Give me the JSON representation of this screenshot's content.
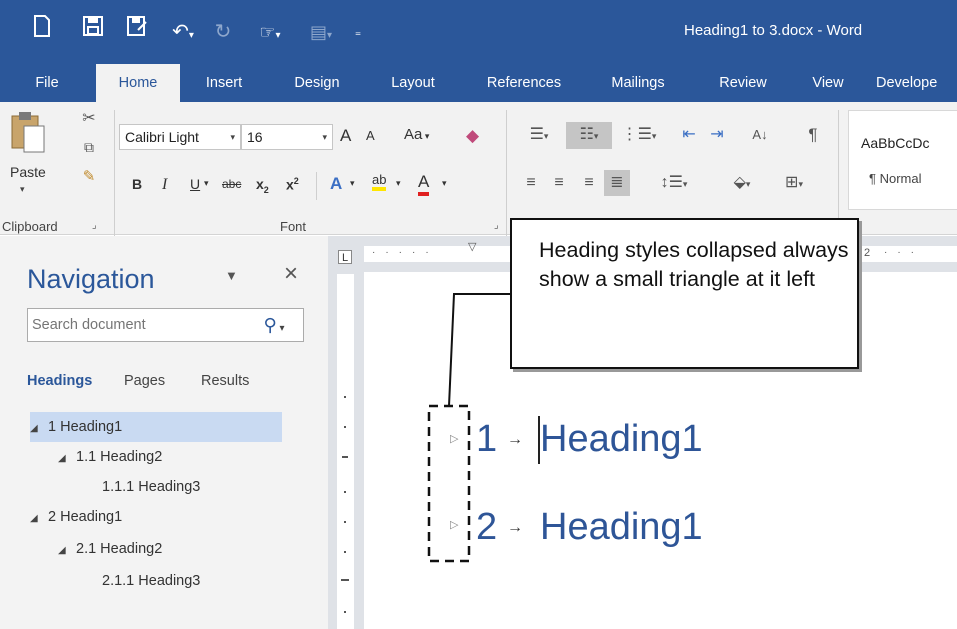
{
  "app": {
    "title": "Heading1 to 3.docx - Word"
  },
  "quick_access": {
    "icons": [
      "new-document-icon",
      "save-icon",
      "save-as-icon",
      "undo-icon",
      "redo-icon",
      "touch-mode-icon",
      "print-preview-icon",
      "customize-icon"
    ]
  },
  "tabs": [
    {
      "label": "File"
    },
    {
      "label": "Home",
      "active": true
    },
    {
      "label": "Insert"
    },
    {
      "label": "Design"
    },
    {
      "label": "Layout"
    },
    {
      "label": "References"
    },
    {
      "label": "Mailings"
    },
    {
      "label": "Review"
    },
    {
      "label": "View"
    },
    {
      "label": "Develope"
    }
  ],
  "ribbon": {
    "clipboard": {
      "paste_label": "Paste",
      "group_label": "Clipboard"
    },
    "font": {
      "font_name": "Calibri Light",
      "font_size": "16",
      "grow_label": "A",
      "shrink_label": "A",
      "case_label": "Aa",
      "bold": "B",
      "italic": "I",
      "underline": "U",
      "strike": "abc",
      "subscript": "x",
      "superscript": "x",
      "effects": "A",
      "highlight": "ab",
      "color": "A",
      "group_label": "Font"
    },
    "paragraph": {
      "pilcrow": "¶"
    },
    "styles": {
      "sample": "AaBbCcDc",
      "name": "¶ Normal"
    }
  },
  "navigation": {
    "title": "Navigation",
    "search_placeholder": "Search document",
    "tabs": [
      {
        "label": "Headings",
        "active": true
      },
      {
        "label": "Pages"
      },
      {
        "label": "Results"
      }
    ],
    "items": [
      {
        "label": "1 Heading1",
        "level": 1,
        "expanded": true,
        "selected": true
      },
      {
        "label": "1.1 Heading2",
        "level": 2,
        "expanded": true
      },
      {
        "label": "1.1.1 Heading3",
        "level": 3
      },
      {
        "label": "2 Heading1",
        "level": 1,
        "expanded": true
      },
      {
        "label": "2.1 Heading2",
        "level": 2,
        "expanded": true
      },
      {
        "label": "2.1.1 Heading3",
        "level": 3
      }
    ]
  },
  "ruler": {
    "h_mark": "2"
  },
  "document": {
    "headings": [
      {
        "number": "1",
        "arrow": "→",
        "text": "Heading1"
      },
      {
        "number": "2",
        "arrow": "→",
        "text": "Heading1"
      }
    ]
  },
  "callout": {
    "text": "Heading styles collapsed always show a small triangle at it left"
  },
  "colors": {
    "word_blue": "#2b579a",
    "heading_blue": "#2e5597",
    "nav_selected": "#c9daf2"
  }
}
